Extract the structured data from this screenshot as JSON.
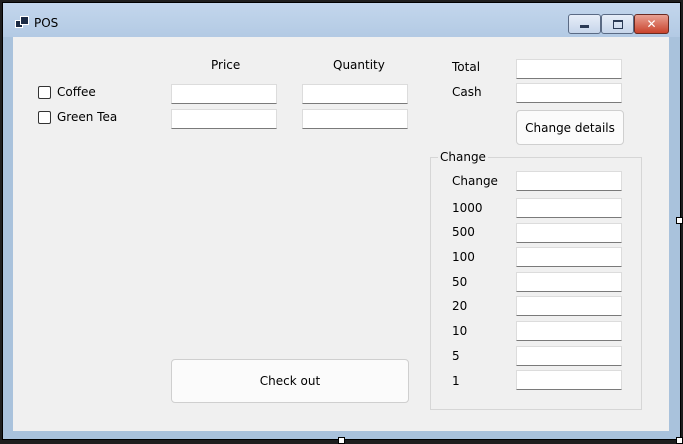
{
  "window": {
    "title": "POS"
  },
  "columns": {
    "price": "Price",
    "quantity": "Quantity"
  },
  "items": [
    {
      "label": "Coffee",
      "checked": false
    },
    {
      "label": "Green Tea",
      "checked": false
    }
  ],
  "summary": {
    "total_label": "Total",
    "cash_label": "Cash",
    "change_details_button": "Change details"
  },
  "change_group": {
    "title": "Change",
    "rows": [
      "Change",
      "1000",
      "500",
      "100",
      "50",
      "20",
      "10",
      "5",
      "1"
    ]
  },
  "checkout_button": "Check out"
}
